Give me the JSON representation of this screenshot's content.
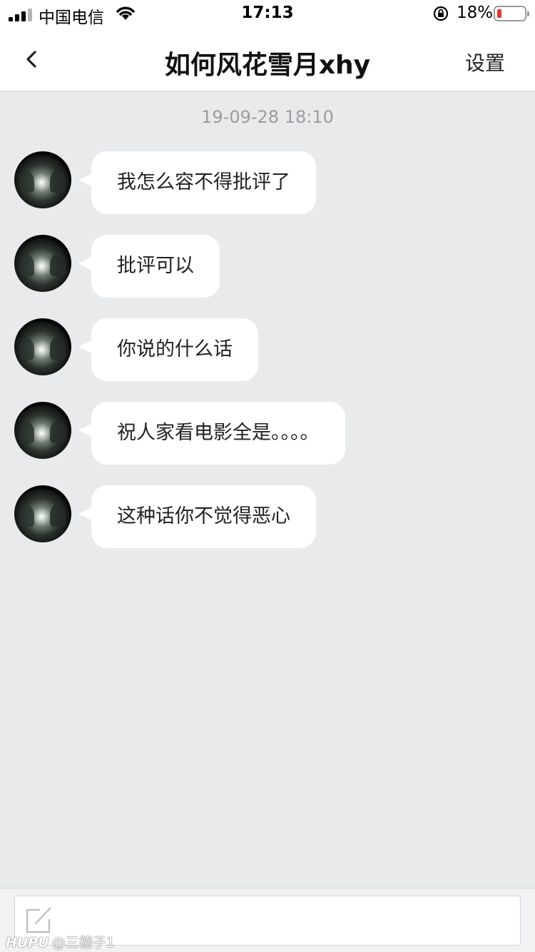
{
  "status_bar": {
    "carrier": "中国电信",
    "time": "17:13",
    "battery_percent": "18%",
    "battery_level": 0.18,
    "battery_color": "#e0352b"
  },
  "nav": {
    "back_icon": "chevron-left-icon",
    "title": "如何风花雪月xhy",
    "settings_label": "设置"
  },
  "chat": {
    "timestamp": "19-09-28 18:10",
    "messages": [
      {
        "text": "我怎么容不得批评了"
      },
      {
        "text": "批评可以"
      },
      {
        "text": "你说的什么话"
      },
      {
        "text": "祝人家看电影全是。。。。"
      },
      {
        "text": "这种话你不觉得恶心"
      }
    ]
  },
  "composer": {
    "icon": "compose-icon"
  },
  "watermark": {
    "logo": "HUPU",
    "handle": "@三德子1"
  }
}
